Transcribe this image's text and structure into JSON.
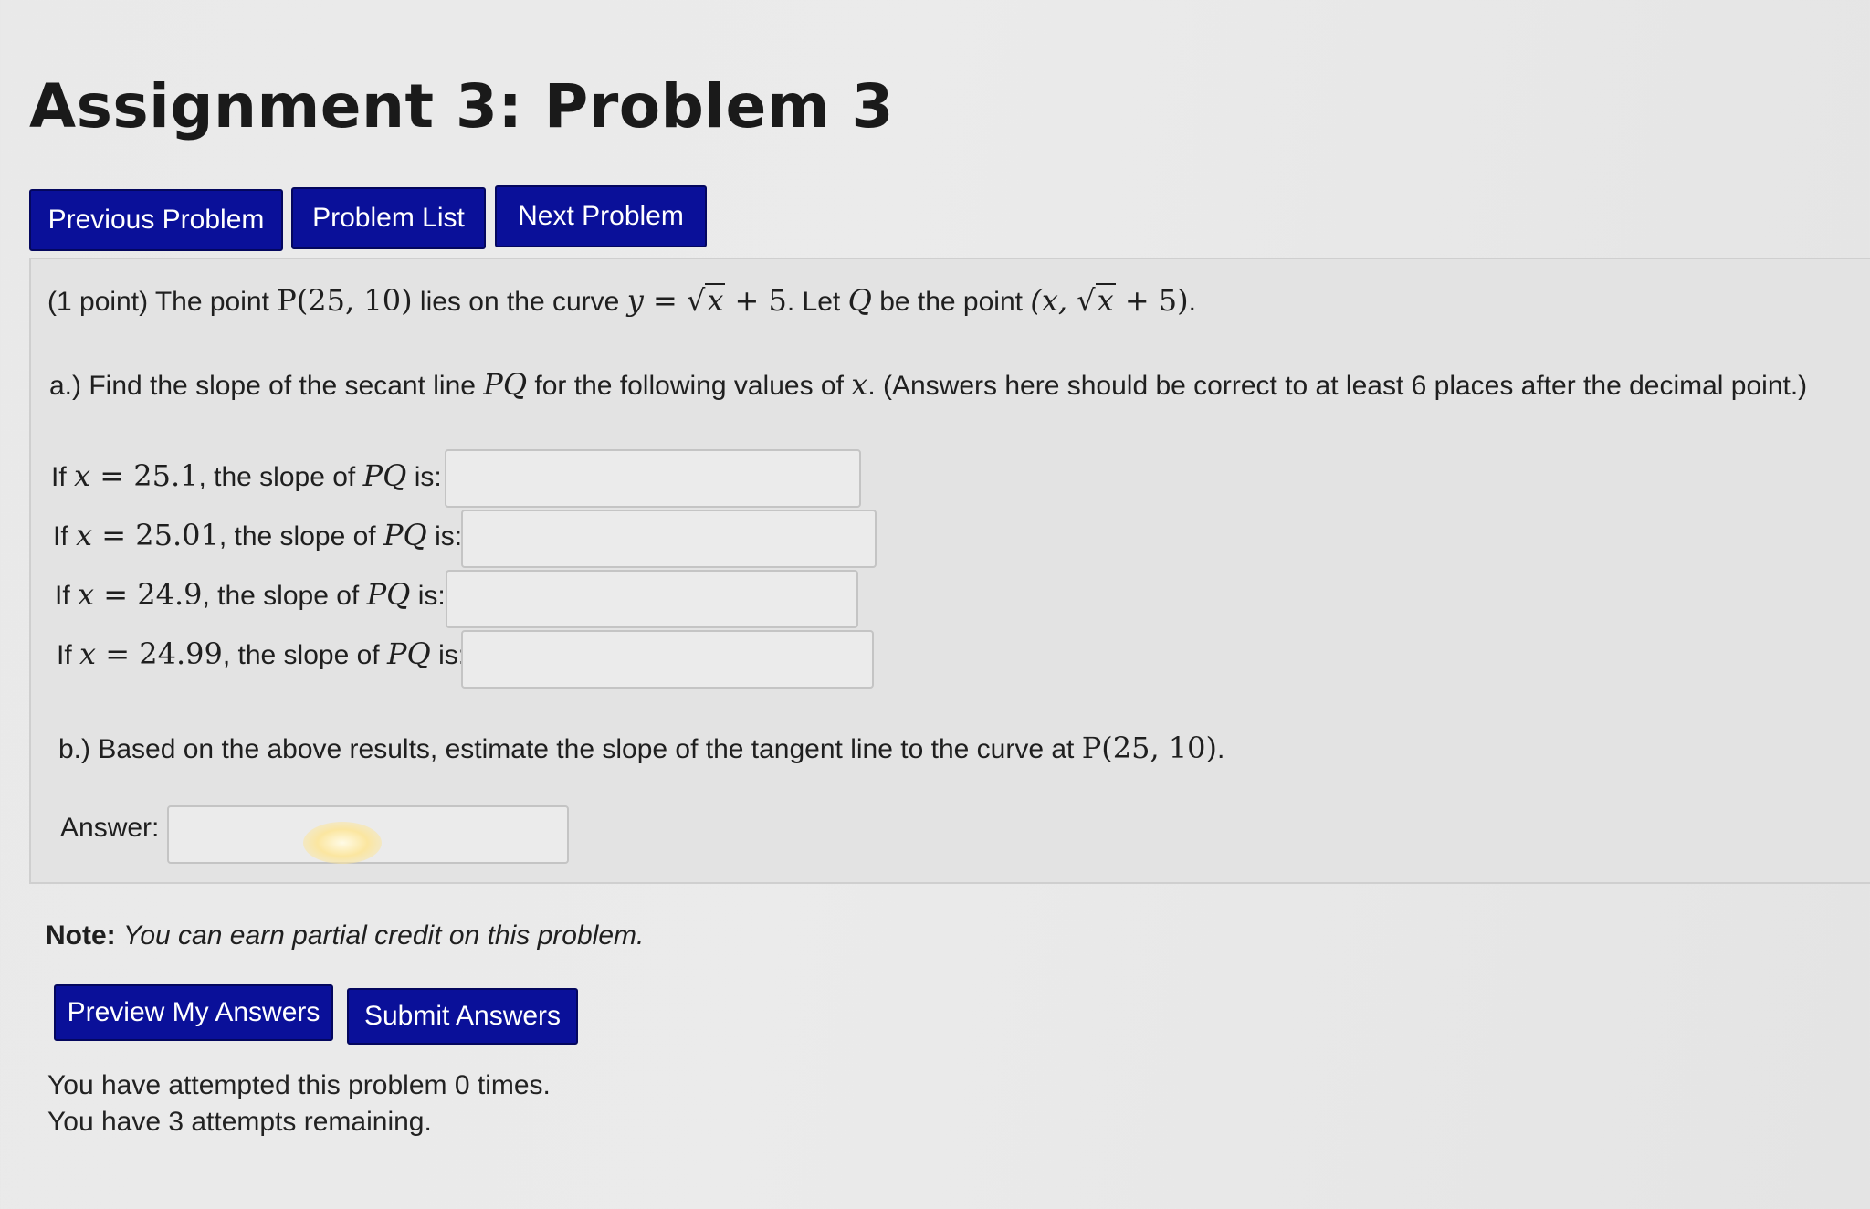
{
  "page": {
    "title": "Assignment 3: Problem 3"
  },
  "nav": {
    "previous_label": "Previous Problem",
    "list_label": "Problem List",
    "next_label": "Next Problem"
  },
  "problem": {
    "intro_prefix": "(1 point) The point",
    "intro_point": "P(25, 10)",
    "intro_mid": "lies on the curve",
    "curve_lhs": "y =",
    "curve_radicand": "x",
    "curve_tail": "+ 5",
    "intro_let": ". Let",
    "intro_Q": "Q",
    "intro_be": "be the point",
    "q_open": "(x,",
    "q_radicand": "x",
    "q_tail": "+ 5)",
    "intro_end": ".",
    "part_a_prefix": "a.) Find the slope of the secant line",
    "part_a_PQ": "PQ",
    "part_a_mid": "for the following values of",
    "part_a_x": "x",
    "part_a_suffix": ". (Answers here should be correct to at least 6 places after the decimal point.)",
    "rows": [
      {
        "if": "If",
        "x": "x",
        "eq": "= 25.1",
        "mid": ", the slope of",
        "pq": "PQ",
        "is": "is:",
        "value": ""
      },
      {
        "if": "If",
        "x": "x",
        "eq": "= 25.01",
        "mid": ", the slope of",
        "pq": "PQ",
        "is": "is:",
        "value": ""
      },
      {
        "if": "If",
        "x": "x",
        "eq": "= 24.9",
        "mid": ", the slope of",
        "pq": "PQ",
        "is": "is:",
        "value": ""
      },
      {
        "if": "If",
        "x": "x",
        "eq": "= 24.99",
        "mid": ", the slope of",
        "pq": "PQ",
        "is": "is:",
        "value": ""
      }
    ],
    "part_b_prefix": "b.) Based on the above results, estimate the slope of the tangent line to the curve at",
    "part_b_point": "P(25, 10)",
    "part_b_end": ".",
    "answer_label": "Answer:",
    "answer_value": ""
  },
  "note": {
    "label": "Note:",
    "text": "You can earn partial credit on this problem."
  },
  "actions": {
    "preview_label": "Preview My Answers",
    "submit_label": "Submit Answers"
  },
  "status": {
    "attempted": "You have attempted this problem 0 times.",
    "remaining": "You have 3 attempts remaining."
  },
  "colors": {
    "button_bg": "#0a1099",
    "button_text": "#ffffff",
    "background": "#e9e9e9"
  }
}
